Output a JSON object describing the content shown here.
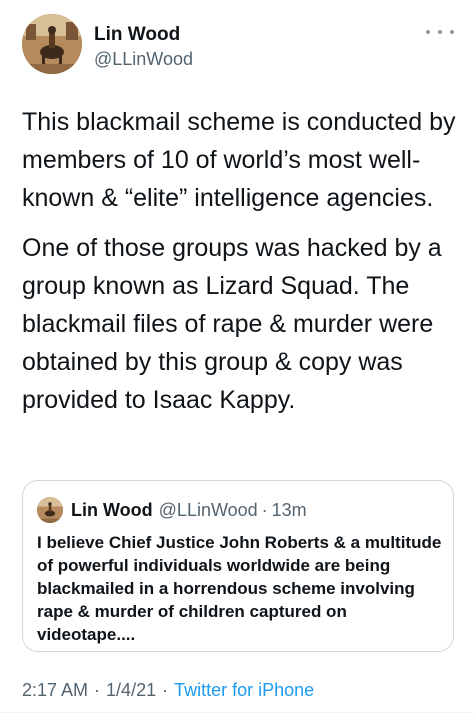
{
  "tweet": {
    "author": {
      "display_name": "Lin Wood",
      "handle": "@LLinWood"
    },
    "paragraphs": [
      "This blackmail scheme is conducted by members of 10 of world’s most well-known & “elite” intelligence agencies.",
      "One of those groups was hacked by a group known as Lizard Squad. The blackmail files of rape & murder were obtained by this group & copy was provided to Isaac Kappy."
    ],
    "quoted": {
      "display_name": "Lin Wood",
      "handle": "@LLinWood",
      "separator": "·",
      "time": "13m",
      "text": "I believe Chief Justice John Roberts & a multitude of powerful individuals worldwide are being blackmailed in a horrendous scheme involving rape & murder of children captured on videotape...."
    },
    "footer": {
      "time": "2:17 AM",
      "separator": "·",
      "date": "1/4/21",
      "client": "Twitter for iPhone"
    },
    "more_icon": "more-horizontal-icon",
    "colors": {
      "text": "#0f1419",
      "secondary": "#536471",
      "link": "#1d9bf0",
      "border": "#cfd9de"
    }
  }
}
